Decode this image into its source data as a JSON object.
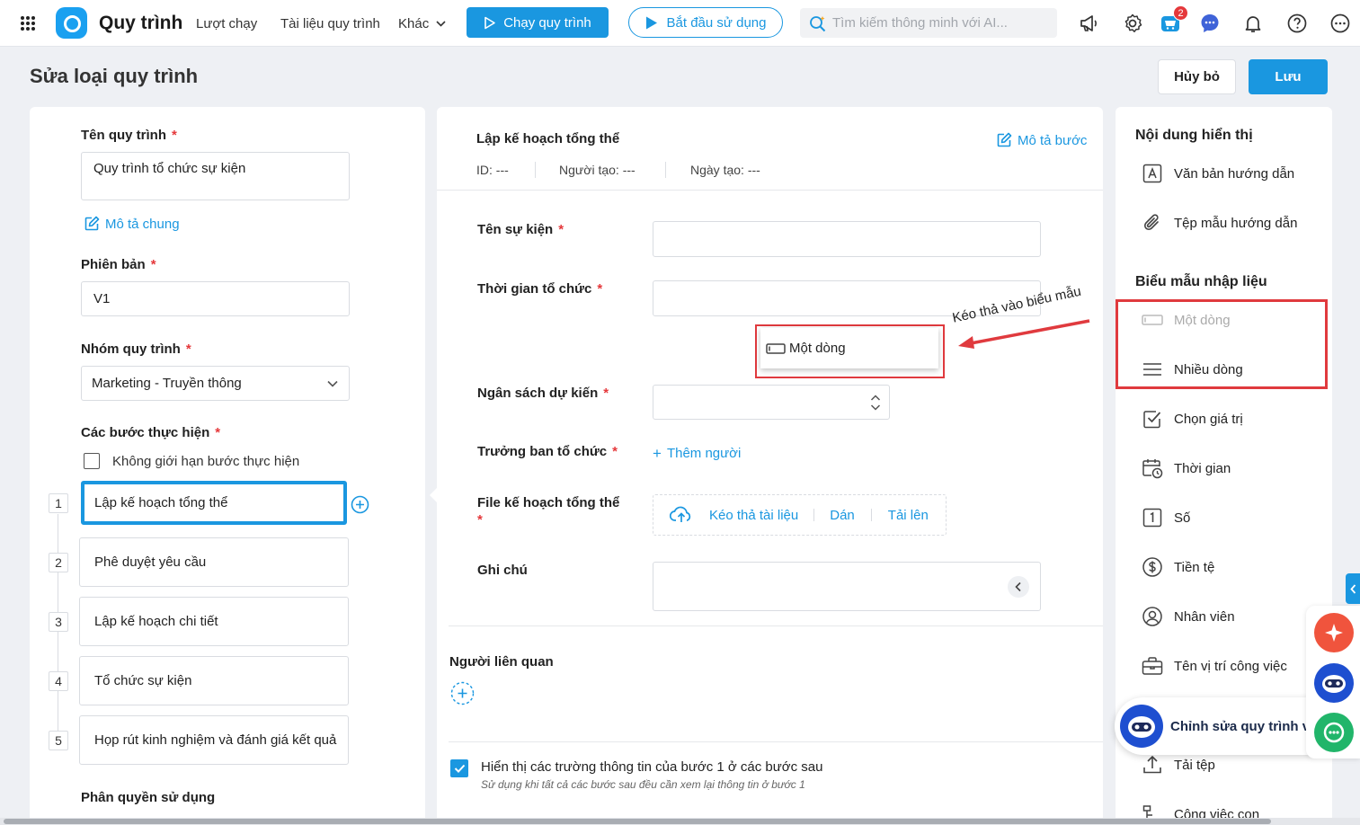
{
  "topbar": {
    "app_title": "Quy trình",
    "nav": [
      "Lượt chạy",
      "Tài liệu quy trình",
      "Khác"
    ],
    "run_button": "Chạy quy trình",
    "start_button": "Bắt đầu sử dụng",
    "search_placeholder": "Tìm kiếm thông minh với AI...",
    "cart_badge": "2"
  },
  "page": {
    "title": "Sửa loại quy trình",
    "cancel": "Hủy bỏ",
    "save": "Lưu"
  },
  "left": {
    "name_label": "Tên quy trình",
    "name_value": "Quy trình tổ chức sự kiện",
    "general_desc": "Mô tả chung",
    "version_label": "Phiên bản",
    "version_value": "V1",
    "group_label": "Nhóm quy trình",
    "group_value": "Marketing - Truyền thông",
    "steps_label": "Các bước thực hiện",
    "no_limit": "Không giới hạn bước thực hiện",
    "steps": [
      {
        "num": "1",
        "label": "Lập kế hoạch tổng thể"
      },
      {
        "num": "2",
        "label": "Phê duyệt yêu cầu"
      },
      {
        "num": "3",
        "label": "Lập kế hoạch chi tiết"
      },
      {
        "num": "4",
        "label": "Tổ chức sự kiện"
      },
      {
        "num": "5",
        "label": "Họp rút kinh nghiệm và đánh giá kết quả"
      }
    ],
    "permission_label": "Phân quyền sử dụng"
  },
  "middle": {
    "step_title": "Lập kế hoạch tổng thể",
    "step_desc": "Mô tả bước",
    "id_label": "ID:",
    "id_value": "---",
    "creator_label": "Người tạo:",
    "creator_value": "---",
    "created_label": "Ngày tạo:",
    "created_value": "---",
    "fields": {
      "event_name": "Tên sự kiện",
      "time": "Thời gian tổ chức",
      "budget": "Ngân sách dự kiến",
      "head": "Trưởng ban tổ chức",
      "file": "File kế hoạch tổng thể",
      "note": "Ghi chú"
    },
    "add_person": "Thêm người",
    "drag_drop": "Kéo thả tài liệu",
    "paste": "Dán",
    "upload": "Tải lên",
    "related_label": "Người liên quan",
    "show_fields": "Hiển thị các trường thông tin của bước 1 ở các bước sau",
    "show_fields_hint": "Sử dụng khi tất cả các bước sau đều cần xem lại thông tin ở bước 1",
    "drag_chip": "Một dòng",
    "annotation": "Kéo thả vào biểu mẫu"
  },
  "right": {
    "display_head": "Nội dung hiển thị",
    "display_items": [
      "Văn bản hướng dẫn",
      "Tệp mẫu hướng dẫn"
    ],
    "form_head": "Biểu mẫu nhập liệu",
    "form_items": [
      "Một dòng",
      "Nhiều dòng",
      "Chọn giá trị",
      "Thời gian",
      "Số",
      "Tiền tệ",
      "Nhân viên",
      "Tên vị trí công việc",
      "Tải tệp",
      "Công việc con"
    ],
    "chat_label": "Chỉnh sửa quy trình với AI"
  },
  "colors": {
    "primary": "#1a97e0",
    "highlight": "#e03a3e",
    "required": "#e5383b"
  }
}
